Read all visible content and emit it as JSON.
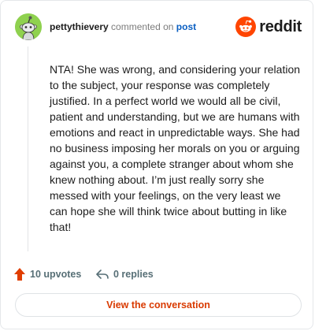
{
  "header": {
    "username": "pettythievery",
    "action_text": "commented on",
    "post_link": "post",
    "brand": "reddit",
    "avatar_icon": "snoo-avatar-icon",
    "logo_icon": "reddit-snoo-icon"
  },
  "comment": {
    "body": "NTA! She was wrong, and considering your relation to the subject, your response was completely justified. In a perfect world we would all be civil, patient and understanding, but we are humans with emotions and react in unpredictable ways. She had no business imposing her morals on you or arguing against you, a complete stranger about whom she knew nothing about. I’m just really sorry she messed with your feelings, on the very least we can hope she will think twice about butting in like that!"
  },
  "footer": {
    "upvotes": "10 upvotes",
    "replies": "0 replies",
    "upvote_icon": "upvote-arrow-icon",
    "reply_icon": "reply-arrow-icon"
  },
  "actions": {
    "view_conversation": "View the conversation"
  },
  "colors": {
    "accent": "#ff4500",
    "link": "#0a5fc2",
    "button_text": "#d93a00",
    "avatar_bg": "#8fd14f"
  }
}
